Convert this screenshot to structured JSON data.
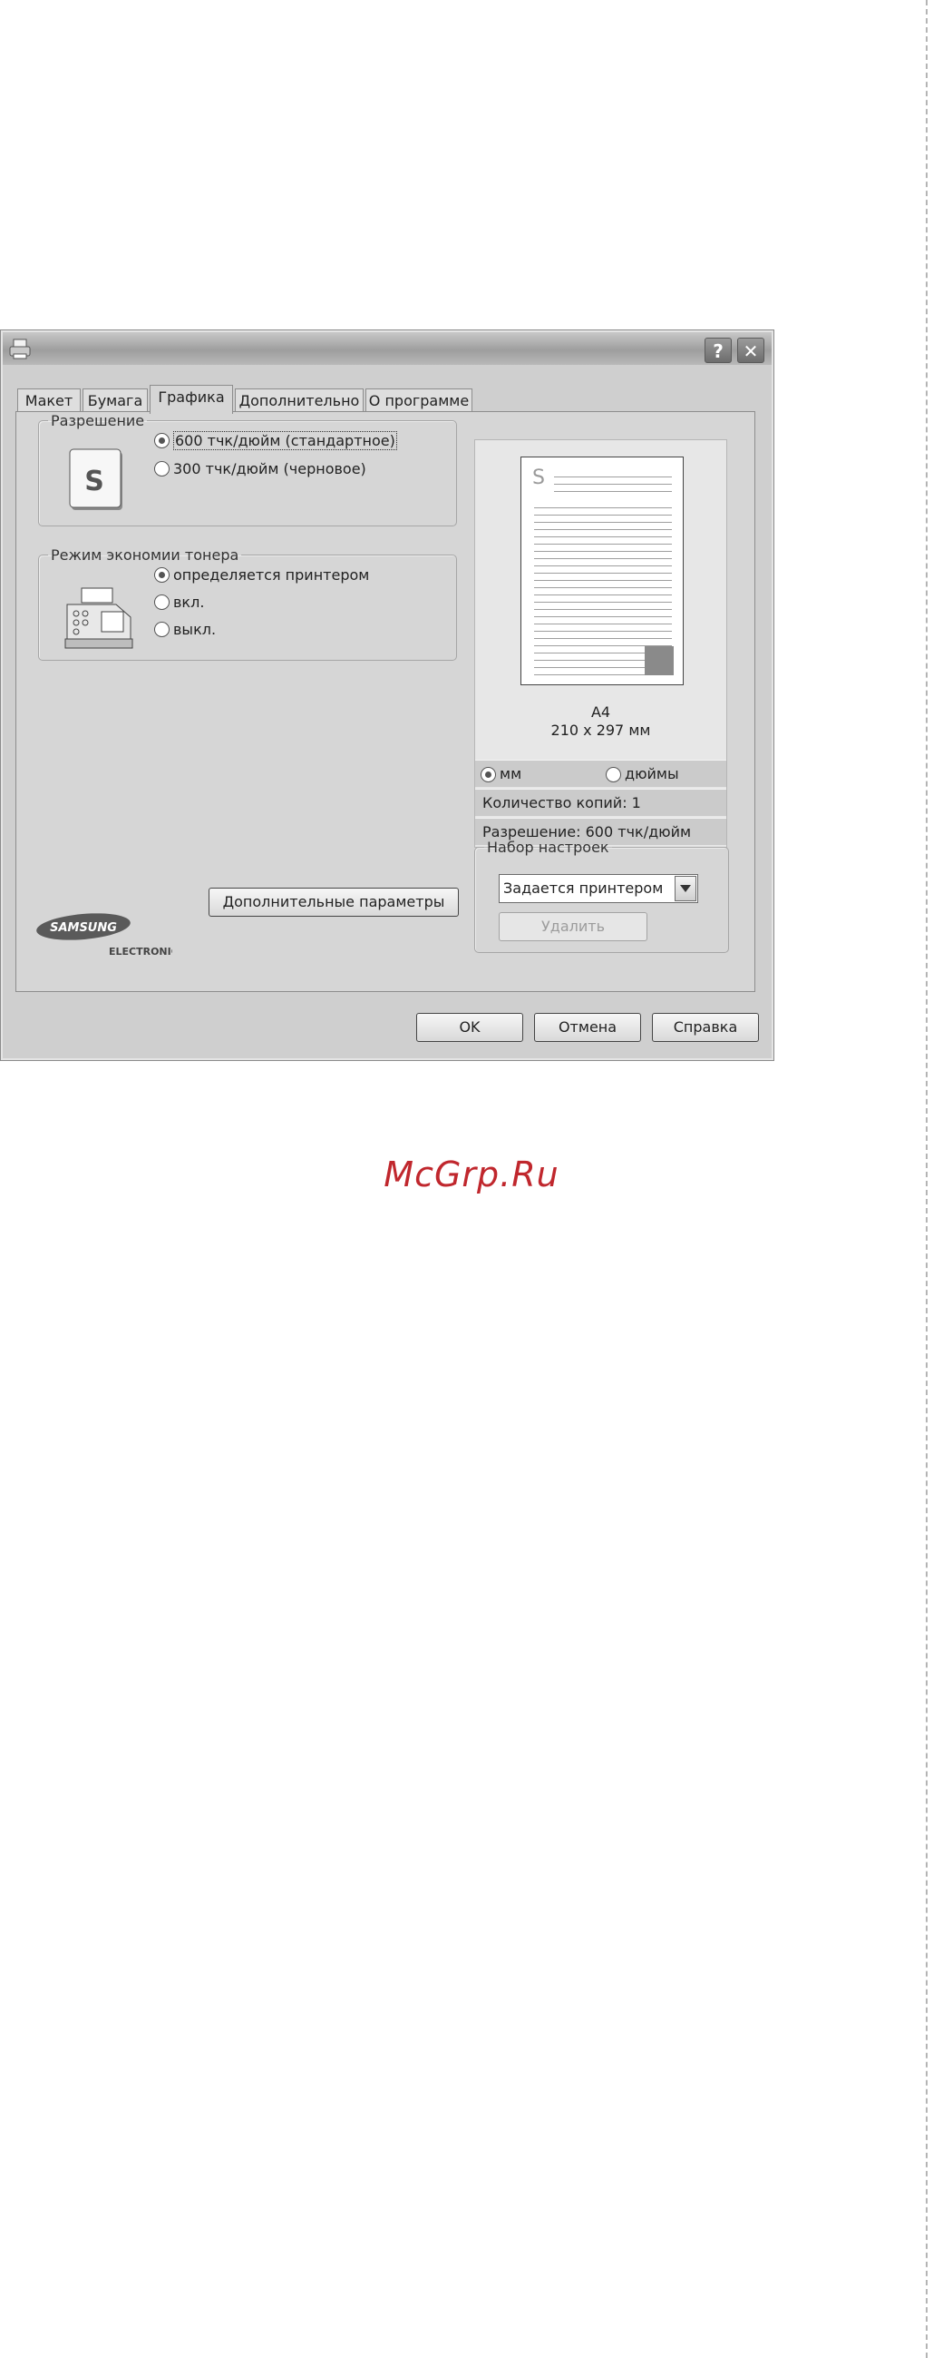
{
  "tabs": [
    "Макет",
    "Бумага",
    "Графика",
    "Дополнительно",
    "О программе"
  ],
  "resolution": {
    "legend": "Разрешение",
    "options": [
      "600 тчк/дюйм (стандартное)",
      "300 тчк/дюйм (черновое)"
    ],
    "selected": "600 тчк/дюйм (стандартное)"
  },
  "toner": {
    "legend": "Режим экономии тонера",
    "options": [
      "определяется принтером",
      "вкл.",
      "выкл."
    ],
    "selected": "определяется принтером"
  },
  "advanced_button": "Дополнительные параметры",
  "brand": {
    "name": "SAMSUNG",
    "sub": "ELECTRONICS"
  },
  "preview": {
    "page_letter": "S",
    "paper_name": "A4",
    "paper_size": "210 x 297 мм",
    "units": [
      "мм",
      "дюймы"
    ],
    "selected_unit": "мм",
    "copies": "Количество копий: 1",
    "resolution": "Разрешение: 600 тчк/дюйм"
  },
  "favorites": {
    "legend": "Набор настроек",
    "selected": "Задается принтером",
    "delete_label": "Удалить"
  },
  "buttons": {
    "ok": "OK",
    "cancel": "Отмена",
    "help": "Справка"
  },
  "titlebar": {
    "help": "?",
    "close": "✕"
  },
  "watermark": "McGrp.Ru"
}
